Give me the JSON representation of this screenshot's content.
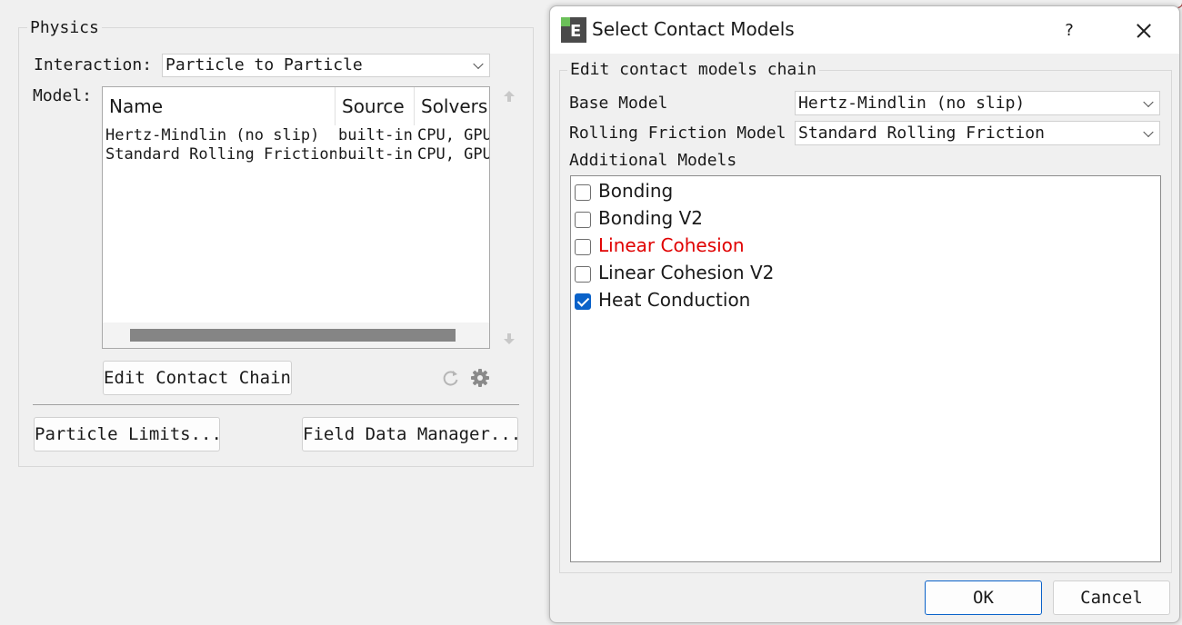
{
  "physics": {
    "group_title": "Physics",
    "interaction_label": "Interaction:",
    "interaction_value": "Particle to Particle",
    "model_label": "Model:",
    "table": {
      "headers": [
        "Name",
        "Source",
        "Solvers"
      ],
      "rows": [
        [
          "Hertz-Mindlin (no slip)",
          "built-in",
          "CPU, GPU"
        ],
        [
          "Standard Rolling Friction",
          "built-in",
          "CPU, GPU"
        ]
      ]
    },
    "edit_chain_button": "Edit Contact Chain",
    "particle_limits_button": "Particle Limits...",
    "field_data_button": "Field Data Manager..."
  },
  "dialog": {
    "title": "Select Contact Models",
    "help_label": "?",
    "group_title": "Edit contact models chain",
    "base_model_label": "Base Model",
    "base_model_value": "Hertz-Mindlin (no slip)",
    "rolling_label": "Rolling Friction Model",
    "rolling_value": "Standard Rolling Friction",
    "additional_label": "Additional Models",
    "items": [
      {
        "label": "Bonding",
        "checked": false,
        "color": "#1a1a1a"
      },
      {
        "label": "Bonding V2",
        "checked": false,
        "color": "#1a1a1a"
      },
      {
        "label": "Linear Cohesion",
        "checked": false,
        "color": "#e00000"
      },
      {
        "label": "Linear Cohesion V2",
        "checked": false,
        "color": "#1a1a1a"
      },
      {
        "label": "Heat Conduction",
        "checked": true,
        "color": "#1a1a1a"
      }
    ],
    "ok_button": "OK",
    "cancel_button": "Cancel"
  },
  "icons": [
    "scroll-up-icon",
    "scroll-down-icon",
    "refresh-icon",
    "gear-icon",
    "app-icon",
    "close-icon",
    "chevron-down-icon"
  ]
}
